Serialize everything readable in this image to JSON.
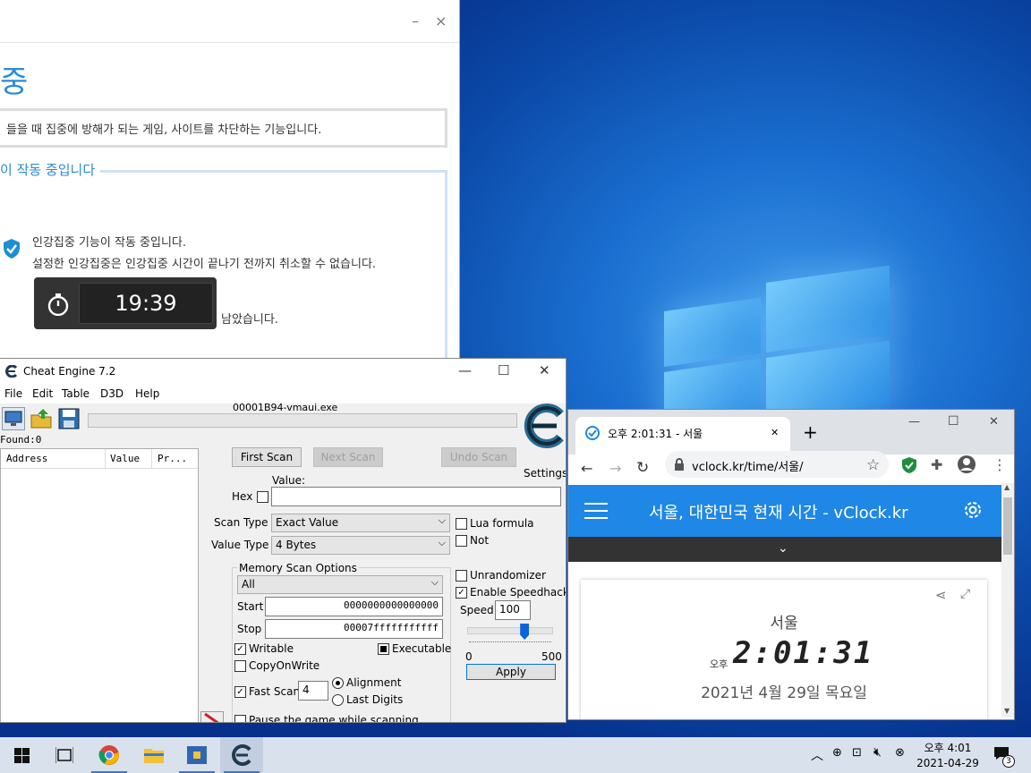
{
  "focus_app": {
    "title_fragment": "중",
    "description": "들을 때 집중에 방해가 되는 게임, 사이트를 차단하는 기능입니다.",
    "section_legend": "이 작동 중입니다",
    "message_line1": "인강집중 기능이 작동 중입니다.",
    "message_line2": "설정한 인강집중은 인강집중 시간이 끝나기 전까지 취소할 수 없습니다.",
    "timer": "19:39",
    "remaining": "남았습니다.",
    "minimize": "–",
    "close": "×"
  },
  "cheat_engine": {
    "title": "Cheat Engine 7.2",
    "menu": [
      "File",
      "Edit",
      "Table",
      "D3D",
      "Help"
    ],
    "process": "00001B94-vmaui.exe",
    "found": "Found:0",
    "columns": [
      "Address",
      "Value",
      "Pr..."
    ],
    "first_scan": "First Scan",
    "next_scan": "Next Scan",
    "undo_scan": "Undo Scan",
    "settings": "Settings",
    "value_label": "Value:",
    "hex_label": "Hex",
    "scan_type_label": "Scan Type",
    "scan_type_value": "Exact Value",
    "value_type_label": "Value Type",
    "value_type_value": "4 Bytes",
    "lua_formula": "Lua formula",
    "not_label": "Not",
    "memory_scan_options": "Memory Scan Options",
    "region": "All",
    "start_label": "Start",
    "start_value": "0000000000000000",
    "stop_label": "Stop",
    "stop_value": "00007fffffffffff",
    "writable": "Writable",
    "executable": "Executable",
    "copy_on_write": "CopyOnWrite",
    "fast_scan": "Fast Scan",
    "fast_scan_value": "4",
    "alignment": "Alignment",
    "last_digits": "Last Digits",
    "pause_game": "Pause the game while scanning",
    "unrandomizer": "Unrandomizer",
    "enable_speedhack": "Enable Speedhack",
    "speed_label": "Speed",
    "speed_value": "100",
    "slider_min": "0",
    "slider_max": "500",
    "speed_level": 0.2,
    "apply": "Apply",
    "minimize": "—",
    "maximize": "☐",
    "close": "✕"
  },
  "chrome": {
    "tab_title": "오후 2:01:31 - 서울",
    "tab_close": "✕",
    "new_tab": "+",
    "url": "vclock.kr/time/서울/",
    "page_title": "서울, 대한민국 현재 시간 - vClock.kr",
    "city": "서울",
    "ampm": "오후",
    "time": "2:01:31",
    "date": "2021년 4월 29일 목요일",
    "minimize": "—",
    "maximize": "☐",
    "close": "✕"
  },
  "taskbar": {
    "clock_time": "오후 4:01",
    "clock_date": "2021-04-29",
    "notification_count": "3"
  },
  "colors": {
    "accent_blue": "#2a8ad8",
    "vclock_blue": "#1f87e5",
    "chrome_green": "#1e8e3e"
  }
}
